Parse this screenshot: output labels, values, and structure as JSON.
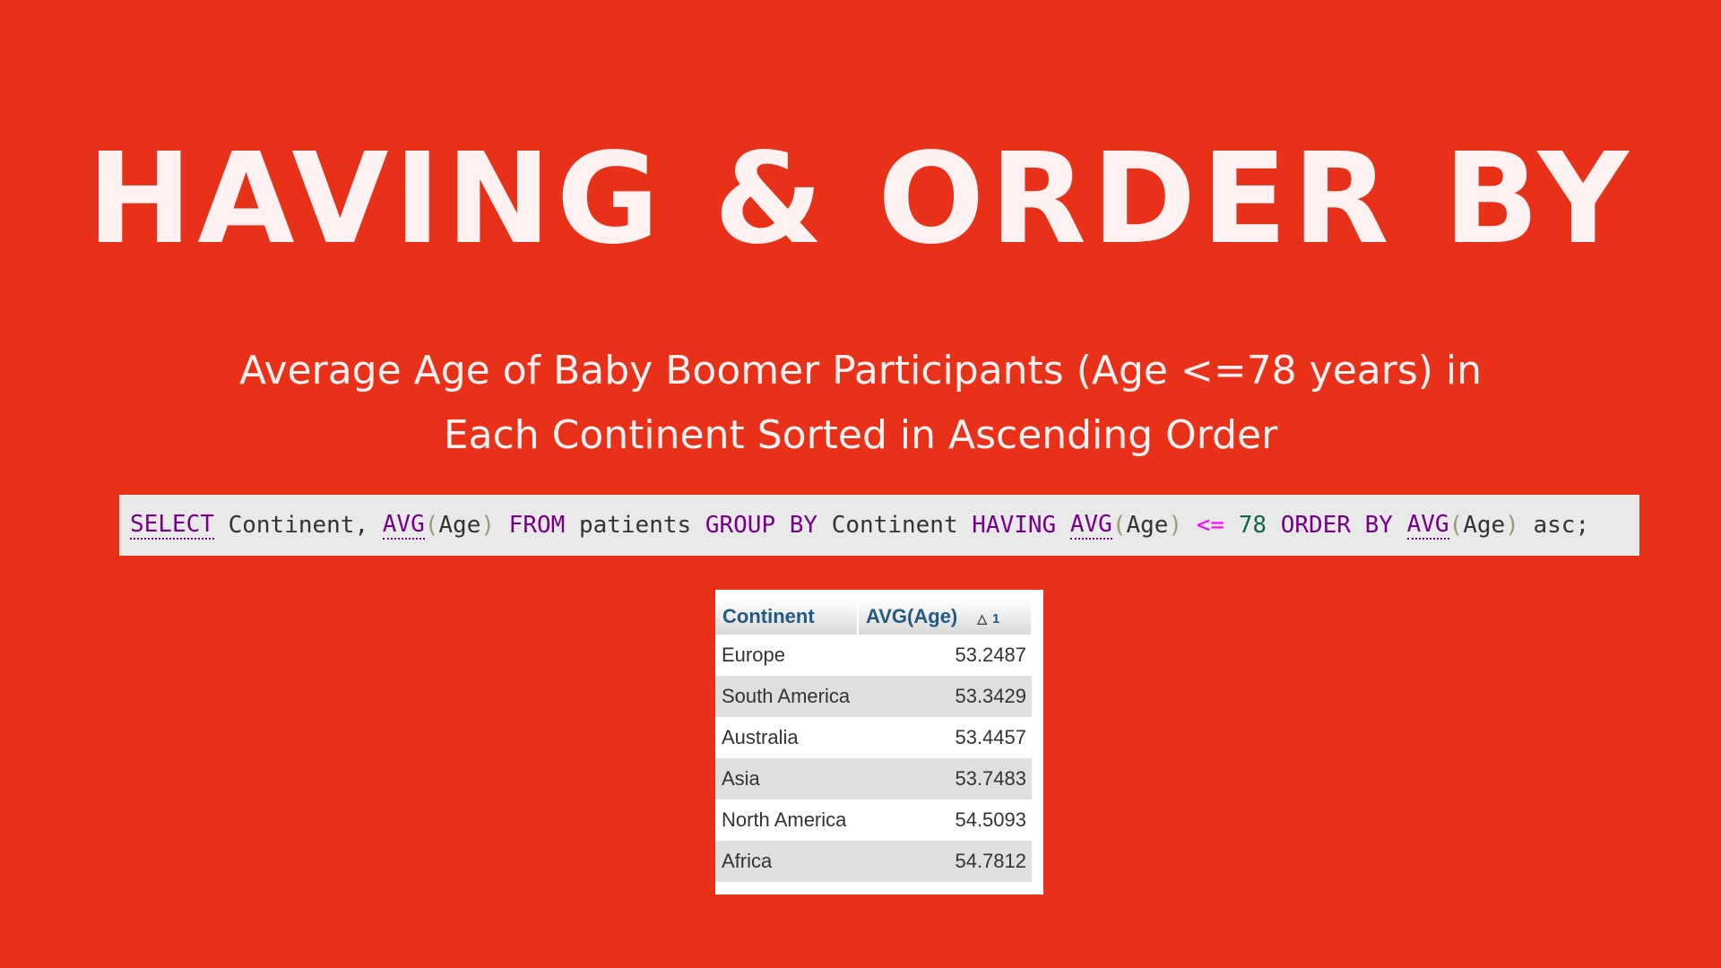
{
  "title": "HAVING & ORDER BY",
  "subtitle": {
    "line1": "Average Age of Baby Boomer Participants (Age <=78 years) in",
    "line2": "Each Continent Sorted in Ascending Order"
  },
  "sql": {
    "tokens": [
      {
        "text": "SELECT",
        "kind": "fn"
      },
      {
        "text": " Continent, ",
        "kind": "ident"
      },
      {
        "text": "AVG",
        "kind": "fn"
      },
      {
        "text": "(",
        "kind": "paren"
      },
      {
        "text": "Age",
        "kind": "ident"
      },
      {
        "text": ")",
        "kind": "paren"
      },
      {
        "text": " FROM ",
        "kind": "kw"
      },
      {
        "text": "patients ",
        "kind": "ident"
      },
      {
        "text": "GROUP BY ",
        "kind": "kw"
      },
      {
        "text": "Continent ",
        "kind": "ident"
      },
      {
        "text": "HAVING ",
        "kind": "kw"
      },
      {
        "text": "AVG",
        "kind": "fn"
      },
      {
        "text": "(",
        "kind": "paren"
      },
      {
        "text": "Age",
        "kind": "ident"
      },
      {
        "text": ")",
        "kind": "paren"
      },
      {
        "text": " <= ",
        "kind": "op"
      },
      {
        "text": "78 ",
        "kind": "num"
      },
      {
        "text": "ORDER BY ",
        "kind": "kw"
      },
      {
        "text": "AVG",
        "kind": "fn"
      },
      {
        "text": "(",
        "kind": "paren"
      },
      {
        "text": "Age",
        "kind": "ident"
      },
      {
        "text": ")",
        "kind": "paren"
      },
      {
        "text": " asc;",
        "kind": "plain"
      }
    ]
  },
  "result": {
    "headers": {
      "continent": "Continent",
      "avg": "AVG(Age)",
      "sort_order": "1"
    },
    "rows": [
      {
        "continent": "Europe",
        "avg": "53.2487"
      },
      {
        "continent": "South America",
        "avg": "53.3429"
      },
      {
        "continent": "Australia",
        "avg": "53.4457"
      },
      {
        "continent": "Asia",
        "avg": "53.7483"
      },
      {
        "continent": "North America",
        "avg": "54.5093"
      },
      {
        "continent": "Africa",
        "avg": "54.7812"
      }
    ]
  },
  "colors": {
    "background": "#e93019",
    "title_text": "#fdf1f2",
    "sql_background": "#e9e9e9",
    "sql_keyword": "#770088",
    "sql_operator": "#ff00ff",
    "sql_number": "#116644",
    "table_header_text": "#235a81",
    "table_row_alt": "#dfdfdf"
  },
  "icons": {
    "sort": "sort-ascending-icon"
  }
}
